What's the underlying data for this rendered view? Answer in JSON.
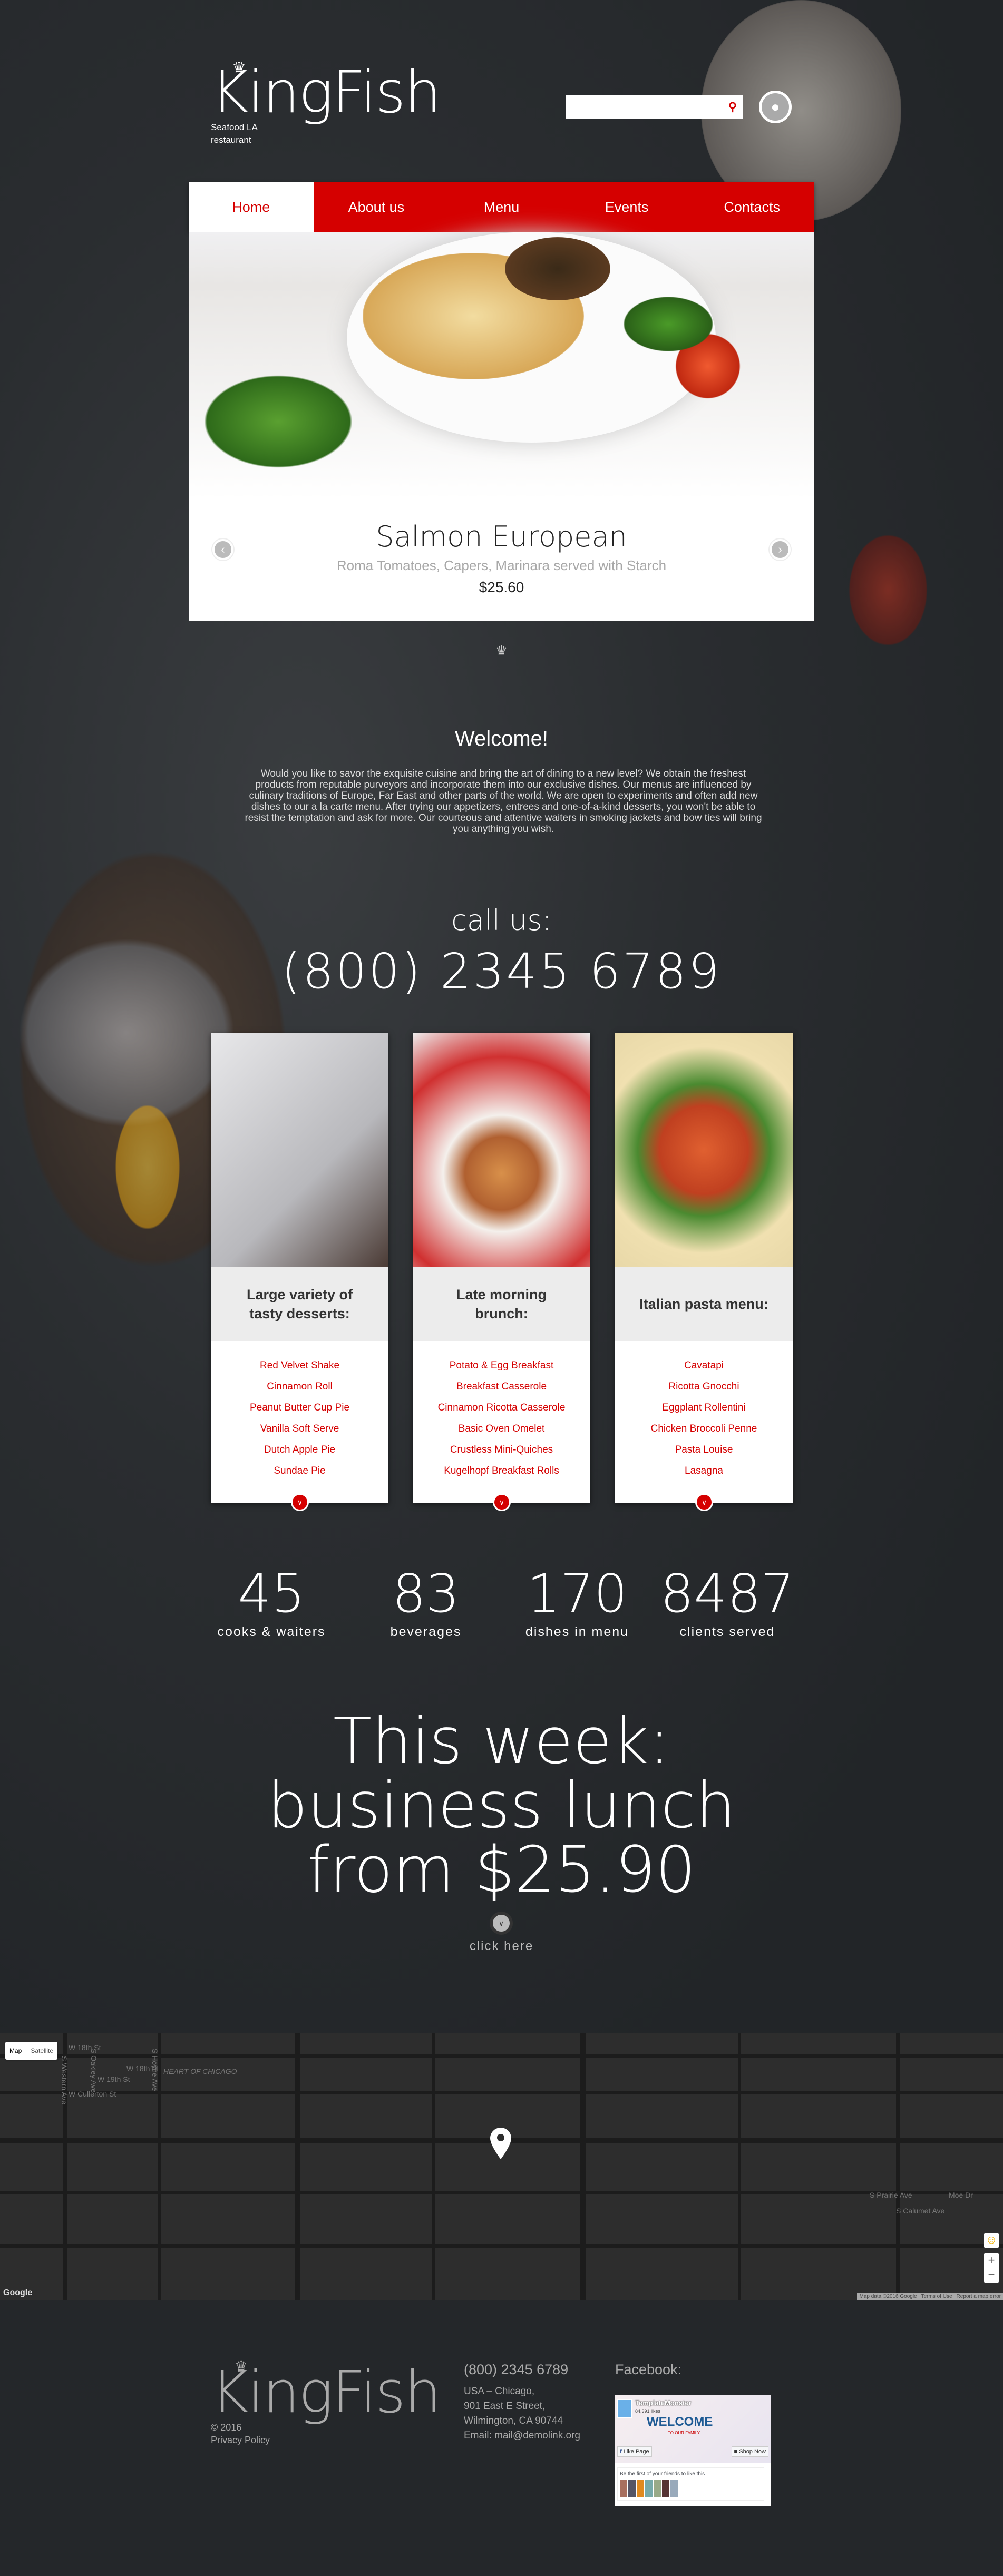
{
  "brand": {
    "name": "KingFish",
    "tagline": "Seafood LA restaurant",
    "accent": "#d50000",
    "background": "#25282b"
  },
  "header": {
    "search_placeholder": "",
    "search_icon": "search-icon",
    "user_icon": "user-icon"
  },
  "nav": [
    {
      "label": "Home",
      "active": true
    },
    {
      "label": "About us"
    },
    {
      "label": "Menu"
    },
    {
      "label": "Events"
    },
    {
      "label": "Contacts"
    }
  ],
  "slider": {
    "title": "Salmon European",
    "subtitle": "Roma Tomatoes, Capers, Marinara served with Starch",
    "price": "$25.60",
    "prev": "‹",
    "next": "›"
  },
  "welcome": {
    "title": "Welcome!",
    "text": "Would you like to savor the exquisite cuisine and bring the art of dining to a new level? We obtain the freshest products from reputable purveyors and incorporate them into our exclusive dishes. Our menus are influenced by culinary traditions of Europe, Far East and other parts of the world. We are open to experiments and often add new dishes to our a la carte menu. After trying our appetizers, entrees and one-of-a-kind desserts, you won't be able to resist the temptation and ask for more. Our courteous and attentive waiters in smoking jackets and bow ties will bring you anything you wish."
  },
  "call": {
    "label": "call us:",
    "phone": "(800) 2345 6789"
  },
  "cards": [
    {
      "title": "Large variety of tasty desserts:",
      "items": [
        "Red Velvet Shake",
        "Cinnamon Roll",
        "Peanut Butter Cup Pie",
        "Vanilla Soft Serve",
        "Dutch Apple Pie",
        "Sundae Pie"
      ]
    },
    {
      "title": "Late morning brunch:",
      "items": [
        "Potato & Egg Breakfast",
        "Breakfast Casserole",
        "Cinnamon Ricotta Casserole",
        "Basic Oven Omelet",
        "Crustless Mini-Quiches",
        "Kugelhopf Breakfast Rolls"
      ]
    },
    {
      "title": "Italian pasta menu:",
      "items": [
        "Cavatapi",
        "Ricotta Gnocchi",
        "Eggplant Rollentini",
        "Chicken Broccoli Penne",
        "Pasta Louise",
        "Lasagna"
      ]
    }
  ],
  "stats": [
    {
      "value": "45",
      "label": "cooks & waiters"
    },
    {
      "value": "83",
      "label": "beverages"
    },
    {
      "value": "170",
      "label": "dishes in menu"
    },
    {
      "value": "8487",
      "label": "clients served"
    }
  ],
  "promo": {
    "line1": "This week:",
    "line2": "business lunch",
    "line3": "from $25.90",
    "cta": "click here"
  },
  "map": {
    "type_map": "Map",
    "type_satellite": "Satellite",
    "labels": [
      "W 18th St",
      "S Oakley Ave",
      "W 18th Pl",
      "S Hoyne Ave",
      "HEART OF CHICAGO",
      "W 19th St",
      "S Western Ave",
      "W Cullerton St",
      "S Prairie Ave",
      "S Calumet Ave",
      "Moe Dr"
    ],
    "zoom_in": "+",
    "zoom_out": "−",
    "attribution": [
      "Map data ©2016 Google",
      "Terms of Use",
      "Report a map error"
    ],
    "google": "Google"
  },
  "footer": {
    "copyright": "© 2016",
    "privacy": "Privacy Policy",
    "phone": "(800) 2345 6789",
    "address": [
      "USA – Chicago,",
      "901 East E Street,",
      "Wilmington, CA 90744"
    ],
    "email_label": "Email:",
    "email": "mail@demolink.org",
    "facebook_title": "Facebook:",
    "fb": {
      "page": "TemplateMonster",
      "likes": "84,391 likes",
      "banner": "WELCOME",
      "banner_sub": "TO OUR FAMILY",
      "like_btn": "Like Page",
      "shop_btn": "Shop Now",
      "friends": "Be the first of your friends to like this"
    }
  }
}
